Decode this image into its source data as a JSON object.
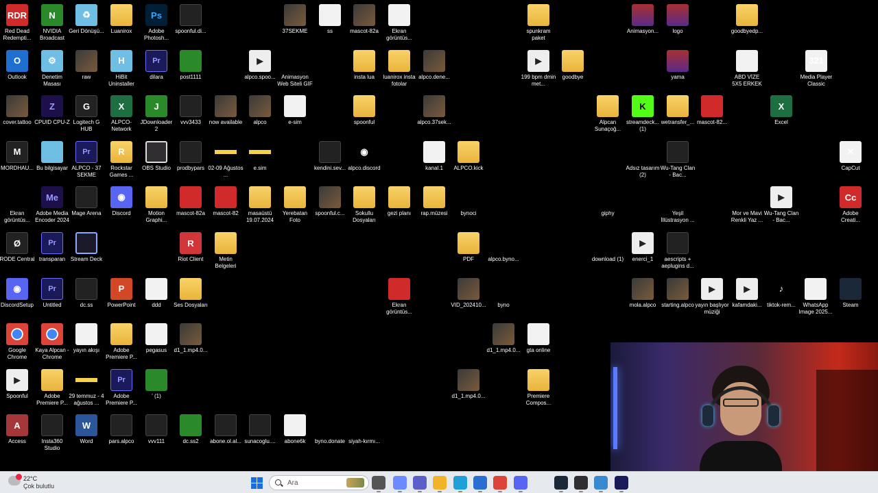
{
  "desktop": {
    "icons": [
      {
        "label": "Red Dead Redempti...",
        "glyph": "RDR",
        "kind": "g-red"
      },
      {
        "label": "NVIDIA Broadcast",
        "glyph": "N",
        "kind": "g-green"
      },
      {
        "label": "Geri Dönüşü...",
        "glyph": "♻",
        "kind": "g-cloud"
      },
      {
        "label": "Luanirox",
        "glyph": "",
        "kind": "g-folder"
      },
      {
        "label": "Adobe Photosh...",
        "glyph": "Ps",
        "kind": "g-ps"
      },
      {
        "label": "spoonful.di...",
        "glyph": "",
        "kind": "g-dark"
      },
      {
        "label": "37SEKME",
        "glyph": "",
        "kind": "g-thumb"
      },
      {
        "label": "ss",
        "glyph": "",
        "kind": "g-doc"
      },
      {
        "label": "mascot-82a",
        "glyph": "",
        "kind": "g-thumb"
      },
      {
        "label": "Ekran görüntüs...",
        "glyph": "",
        "kind": "g-doc"
      },
      {
        "label": "spunkram paket",
        "glyph": "",
        "kind": "g-folder"
      },
      {
        "label": "Animasyon...",
        "glyph": "",
        "kind": "g-winrar"
      },
      {
        "label": "logo",
        "glyph": "",
        "kind": "g-winrar"
      },
      {
        "label": "goodbyedp...",
        "glyph": "",
        "kind": "g-folder"
      },
      {
        "label": "Outlook",
        "glyph": "O",
        "kind": "g-blue"
      },
      {
        "label": "Denetim Masası",
        "glyph": "⚙",
        "kind": "g-cloud"
      },
      {
        "label": "raw",
        "glyph": "",
        "kind": "g-thumb"
      },
      {
        "label": "HiBit Uninstaller",
        "glyph": "H",
        "kind": "g-cloud"
      },
      {
        "label": "dilara",
        "glyph": "Pr",
        "kind": "g-pr"
      },
      {
        "label": "post1111",
        "glyph": "",
        "kind": "g-green"
      },
      {
        "label": "alpco.spoo...",
        "glyph": "▶",
        "kind": "g-video"
      },
      {
        "label": "Animasyon Web Siteli GIF",
        "glyph": "",
        "kind": "g-none"
      },
      {
        "label": "insta lua",
        "glyph": "",
        "kind": "g-folder"
      },
      {
        "label": "luanirox insta fotolar",
        "glyph": "",
        "kind": "g-folder"
      },
      {
        "label": "alpco.dene...",
        "glyph": "",
        "kind": "g-thumb"
      },
      {
        "label": "199 bpm dmin met...",
        "glyph": "▶",
        "kind": "g-video"
      },
      {
        "label": "goodbye",
        "glyph": "",
        "kind": "g-folder"
      },
      {
        "label": "yama",
        "glyph": "",
        "kind": "g-winrar"
      },
      {
        "label": "ABD VİZE 5X5 ERKEK",
        "glyph": "",
        "kind": "g-doc"
      },
      {
        "label": "Media Player Classic",
        "glyph": "321",
        "kind": "g-doc"
      },
      {
        "label": "cover.tattoo",
        "glyph": "",
        "kind": "g-thumb"
      },
      {
        "label": "CPUID CPU-Z",
        "glyph": "Z",
        "kind": "g-me"
      },
      {
        "label": "Logitech G HUB",
        "glyph": "G",
        "kind": "g-dark"
      },
      {
        "label": "ALPCO-Network",
        "glyph": "X",
        "kind": "g-excel"
      },
      {
        "label": "JDownloader 2",
        "glyph": "J",
        "kind": "g-green"
      },
      {
        "label": "vvv3433",
        "glyph": "",
        "kind": "g-dark"
      },
      {
        "label": "now available",
        "glyph": "",
        "kind": "g-thumb"
      },
      {
        "label": "alpco",
        "glyph": "",
        "kind": "g-thumb"
      },
      {
        "label": "e-sim",
        "glyph": "",
        "kind": "g-doc"
      },
      {
        "label": "spoonful",
        "glyph": "",
        "kind": "g-folder"
      },
      {
        "label": "alpco.37sek...",
        "glyph": "",
        "kind": "g-thumb"
      },
      {
        "label": "Alpcan Sunaçoğ...",
        "glyph": "",
        "kind": "g-folder"
      },
      {
        "label": "streamdeck... (1)",
        "glyph": "K",
        "kind": "g-kick"
      },
      {
        "label": "wetransfer_...",
        "glyph": "",
        "kind": "g-folder"
      },
      {
        "label": "mascot-82...",
        "glyph": "",
        "kind": "g-red"
      },
      {
        "label": "Excel",
        "glyph": "X",
        "kind": "g-excel"
      },
      {
        "label": "MORDHAU...",
        "glyph": "M",
        "kind": "g-dark"
      },
      {
        "label": "Bu bilgisayar",
        "glyph": "",
        "kind": "g-cloud"
      },
      {
        "label": "ALPCO - 37 SEKME",
        "glyph": "Pr",
        "kind": "g-pr"
      },
      {
        "label": "Rockstar Games ...",
        "glyph": "R",
        "kind": "g-folder"
      },
      {
        "label": "OBS Studio",
        "glyph": "",
        "kind": "g-obs"
      },
      {
        "label": "prodbypars",
        "glyph": "",
        "kind": "g-dark"
      },
      {
        "label": "02-09 Ağustos ...",
        "glyph": "",
        "kind": "g-yellowbar"
      },
      {
        "label": "e.sim",
        "glyph": "",
        "kind": "g-yellowbar"
      },
      {
        "label": "kendini.sev...",
        "glyph": "",
        "kind": "g-dark"
      },
      {
        "label": "alpco.discord",
        "glyph": "◉",
        "kind": "g-none"
      },
      {
        "label": "kanal.1",
        "glyph": "",
        "kind": "g-doc"
      },
      {
        "label": "ALPCO.kick",
        "glyph": "",
        "kind": "g-folder"
      },
      {
        "label": "Adsız tasarım (2)",
        "glyph": "",
        "kind": "g-none"
      },
      {
        "label": "Wu-Tang Clan - Bac...",
        "glyph": "",
        "kind": "g-dark"
      },
      {
        "label": "CapCut",
        "glyph": "✕",
        "kind": "g-doc"
      },
      {
        "label": "Ekran görüntüs...",
        "glyph": "",
        "kind": "g-none"
      },
      {
        "label": "Adobe Media Encoder 2024",
        "glyph": "Me",
        "kind": "g-me"
      },
      {
        "label": "Mage Arena",
        "glyph": "",
        "kind": "g-dark"
      },
      {
        "label": "Discord",
        "glyph": "◉",
        "kind": "g-discord"
      },
      {
        "label": "Motion Graphi...",
        "glyph": "",
        "kind": "g-folder"
      },
      {
        "label": "mascot-82a",
        "glyph": "",
        "kind": "g-red"
      },
      {
        "label": "mascot-82",
        "glyph": "",
        "kind": "g-red"
      },
      {
        "label": "masaüstü 19.07.2024",
        "glyph": "",
        "kind": "g-folder"
      },
      {
        "label": "Yerebatan Foto",
        "glyph": "",
        "kind": "g-folder"
      },
      {
        "label": "spoonful.c...",
        "glyph": "",
        "kind": "g-thumb"
      },
      {
        "label": "Sokullu Dosyaları",
        "glyph": "",
        "kind": "g-folder"
      },
      {
        "label": "gezi planı",
        "glyph": "",
        "kind": "g-folder"
      },
      {
        "label": "rap.müzesi",
        "glyph": "",
        "kind": "g-folder"
      },
      {
        "label": "bynoci",
        "glyph": "",
        "kind": "g-none"
      },
      {
        "label": "giphy",
        "glyph": "",
        "kind": "g-none"
      },
      {
        "label": "Yeşil İllüstrasyon ...",
        "glyph": "",
        "kind": "g-none"
      },
      {
        "label": "Mor ve Mavi Renkli Yaz ...",
        "glyph": "",
        "kind": "g-none"
      },
      {
        "label": "Wu-Tang Clan - Bac...",
        "glyph": "▶",
        "kind": "g-video"
      },
      {
        "label": "Adobe Creati...",
        "glyph": "Cc",
        "kind": "g-red"
      },
      {
        "label": "RODE Central",
        "glyph": "Ø",
        "kind": "g-dark"
      },
      {
        "label": "transparan",
        "glyph": "Pr",
        "kind": "g-pr"
      },
      {
        "label": "Stream Deck",
        "glyph": "",
        "kind": "g-stream"
      },
      {
        "label": "Riot Client",
        "glyph": "R",
        "kind": "g-riot"
      },
      {
        "label": "Metin Belgeleri",
        "glyph": "",
        "kind": "g-folder"
      },
      {
        "label": "PDF",
        "glyph": "",
        "kind": "g-folder"
      },
      {
        "label": "alpco.byno...",
        "glyph": "",
        "kind": "g-none"
      },
      {
        "label": "download (1)",
        "glyph": "",
        "kind": "g-none"
      },
      {
        "label": "enerci_1",
        "glyph": "▶",
        "kind": "g-video"
      },
      {
        "label": "aescripts + aeplugins d...",
        "glyph": "",
        "kind": "g-dark"
      },
      {
        "label": "DiscordSetup",
        "glyph": "◉",
        "kind": "g-discord"
      },
      {
        "label": "Untitled",
        "glyph": "Pr",
        "kind": "g-pr"
      },
      {
        "label": "dc.ss",
        "glyph": "",
        "kind": "g-dark"
      },
      {
        "label": "PowerPoint",
        "glyph": "P",
        "kind": "g-ppt"
      },
      {
        "label": "ddd",
        "glyph": "",
        "kind": "g-doc"
      },
      {
        "label": "Ses Dosyaları",
        "glyph": "",
        "kind": "g-folder"
      },
      {
        "label": "Ekran görüntüs...",
        "glyph": "",
        "kind": "g-red"
      },
      {
        "label": "VID_202410...",
        "glyph": "",
        "kind": "g-thumb"
      },
      {
        "label": "byno",
        "glyph": "",
        "kind": "g-none"
      },
      {
        "label": "mola.alpco",
        "glyph": "",
        "kind": "g-thumb"
      },
      {
        "label": "starting.alpco",
        "glyph": "",
        "kind": "g-thumb"
      },
      {
        "label": "yayın başlıyor müziği",
        "glyph": "▶",
        "kind": "g-video"
      },
      {
        "label": "kafamdaki...",
        "glyph": "▶",
        "kind": "g-video"
      },
      {
        "label": "tiktok-rem...",
        "glyph": "♪",
        "kind": "g-none"
      },
      {
        "label": "WhatsApp Image 2025...",
        "glyph": "",
        "kind": "g-doc"
      },
      {
        "label": "Steam",
        "glyph": "",
        "kind": "g-steam"
      },
      {
        "label": "Google Chrome",
        "glyph": "",
        "kind": "g-chrome"
      },
      {
        "label": "Kaya Alpcan - Chrome",
        "glyph": "",
        "kind": "g-chrome"
      },
      {
        "label": "yayın akışı",
        "glyph": "",
        "kind": "g-doc"
      },
      {
        "label": "Adobe Premiere P...",
        "glyph": "",
        "kind": "g-folder"
      },
      {
        "label": "pegasus",
        "glyph": "",
        "kind": "g-doc"
      },
      {
        "label": "d1_1.mp4.0...",
        "glyph": "",
        "kind": "g-thumb"
      },
      {
        "label": "d1_1.mp4.0...",
        "glyph": "",
        "kind": "g-thumb"
      },
      {
        "label": "gta online",
        "glyph": "",
        "kind": "g-doc"
      },
      {
        "label": "Spoonful",
        "glyph": "▶",
        "kind": "g-video"
      },
      {
        "label": "Adobe Premiere P...",
        "glyph": "",
        "kind": "g-folder"
      },
      {
        "label": "29 temmuz - 4 ağustos ...",
        "glyph": "",
        "kind": "g-yellowbar"
      },
      {
        "label": "Adobe Premiere P...",
        "glyph": "Pr",
        "kind": "g-pr"
      },
      {
        "label": "' (1)",
        "glyph": "",
        "kind": "g-green"
      },
      {
        "label": "d1_1.mp4.0...",
        "glyph": "",
        "kind": "g-thumb"
      },
      {
        "label": "Premiere Compos...",
        "glyph": "",
        "kind": "g-folder"
      },
      {
        "label": "Access",
        "glyph": "A",
        "kind": "g-access"
      },
      {
        "label": "Insta360 Studio",
        "glyph": "",
        "kind": "g-dark"
      },
      {
        "label": "Word",
        "glyph": "W",
        "kind": "g-word"
      },
      {
        "label": "pars.alpco",
        "glyph": "",
        "kind": "g-dark"
      },
      {
        "label": "vvv111",
        "glyph": "",
        "kind": "g-dark"
      },
      {
        "label": "dc.ss2",
        "glyph": "",
        "kind": "g-green"
      },
      {
        "label": "abone.ol.al...",
        "glyph": "",
        "kind": "g-dark"
      },
      {
        "label": "sunacoglu....",
        "glyph": "",
        "kind": "g-dark"
      },
      {
        "label": "abone6k",
        "glyph": "",
        "kind": "g-doc"
      },
      {
        "label": "byno.donate",
        "glyph": "",
        "kind": "g-none"
      },
      {
        "label": "siyah-kırmı...",
        "glyph": "",
        "kind": "g-none"
      }
    ]
  },
  "taskbar": {
    "weather": {
      "temp": "22°C",
      "desc": "Çok bulutlu"
    },
    "search": {
      "placeholder": "Ara"
    },
    "apps": [
      {
        "name": "task-view",
        "color": "#555"
      },
      {
        "name": "copilot",
        "color": "#6a8aff"
      },
      {
        "name": "teams",
        "color": "#5b5fc7"
      },
      {
        "name": "file-explorer",
        "color": "#f0b429"
      },
      {
        "name": "edge",
        "color": "#1fa0d8"
      },
      {
        "name": "store",
        "color": "#2a6fd0"
      },
      {
        "name": "chrome",
        "color": "#db4437"
      },
      {
        "name": "discord",
        "color": "#5865f2"
      },
      {
        "name": "steam",
        "color": "#1b2838"
      },
      {
        "name": "obs",
        "color": "#302e31"
      },
      {
        "name": "network",
        "color": "#3a8ad0"
      },
      {
        "name": "premiere",
        "color": "#1a1a5a"
      }
    ]
  }
}
